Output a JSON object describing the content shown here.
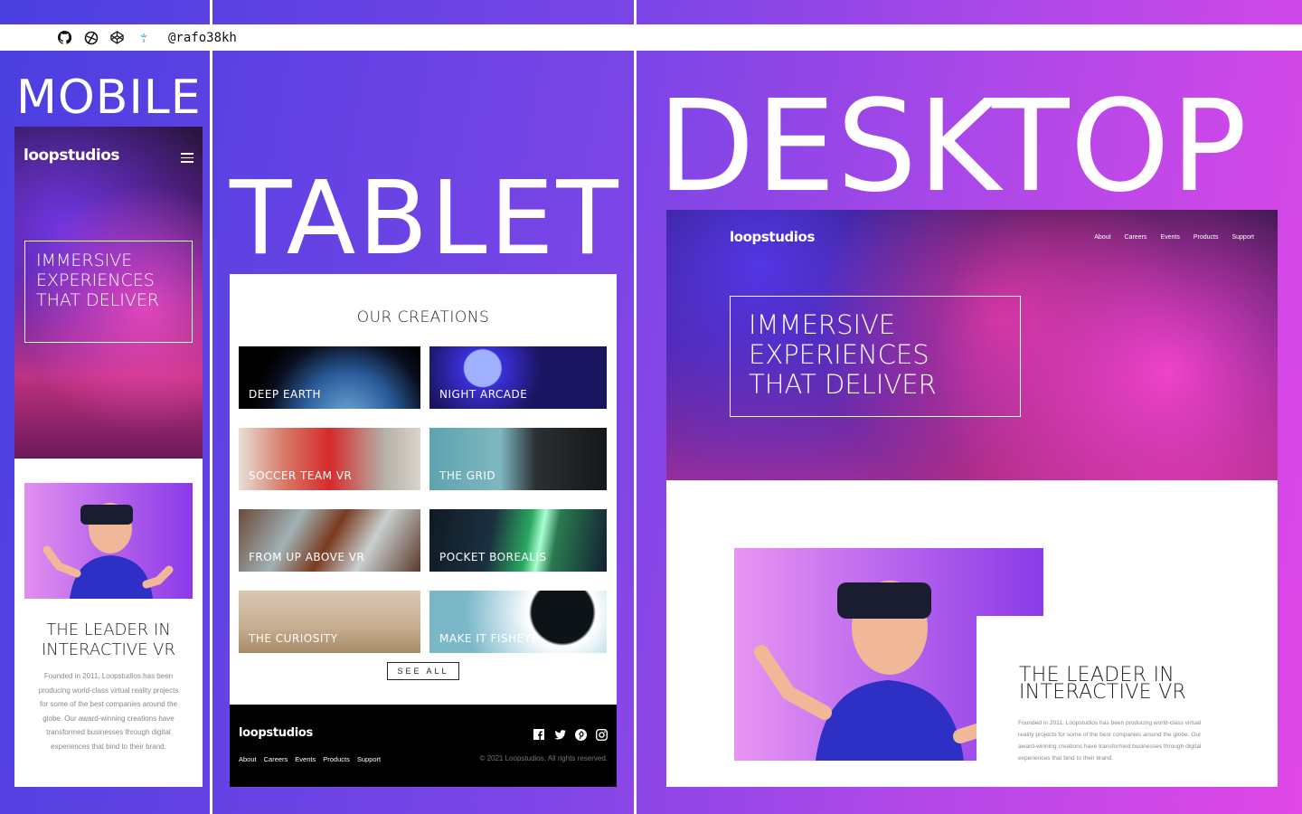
{
  "labels": {
    "mobile": "MOBILE",
    "tablet": "TABLET",
    "desktop": "DESKTOP"
  },
  "topbar": {
    "icons": [
      "github-icon",
      "frontend-mentor-icon",
      "codepen-icon",
      "sparkle-icon"
    ],
    "handle": "@rafo38kh"
  },
  "brand": {
    "logo": "loopstudios"
  },
  "hero": {
    "headline_mobile": "IMMERSIVE EXPERIENCES THAT DELIVER",
    "headline_desktop": "IMMERSIVE EXPERIENCES THAT DELIVER"
  },
  "about": {
    "heading": "THE LEADER IN INTERACTIVE VR",
    "text": "Founded in 2011, Loopstudios has been producing world-class virtual reality projects for some of the best companies around the globe. Our award-winning creations have transformed businesses through digital experiences that bind to their brand."
  },
  "creations": {
    "title": "OUR CREATIONS",
    "items": [
      {
        "label": "DEEP EARTH"
      },
      {
        "label": "NIGHT ARCADE"
      },
      {
        "label": "SOCCER TEAM VR"
      },
      {
        "label": "THE GRID"
      },
      {
        "label": "FROM UP ABOVE VR"
      },
      {
        "label": "POCKET BOREALIS"
      },
      {
        "label": "THE CURIOSITY"
      },
      {
        "label": "MAKE IT FISHEYE"
      }
    ],
    "see_all": "SEE ALL"
  },
  "nav": {
    "items": [
      "About",
      "Careers",
      "Events",
      "Products",
      "Support"
    ]
  },
  "footer": {
    "logo": "loopstudios",
    "nav": [
      "About",
      "Careers",
      "Events",
      "Products",
      "Support"
    ],
    "social": [
      "facebook-icon",
      "twitter-icon",
      "pinterest-icon",
      "instagram-icon"
    ],
    "copyright": "© 2021 Loopstudios. All rights reserved."
  },
  "colors": {
    "accent": "#4a3fe0",
    "accent_end": "#e047e6"
  }
}
